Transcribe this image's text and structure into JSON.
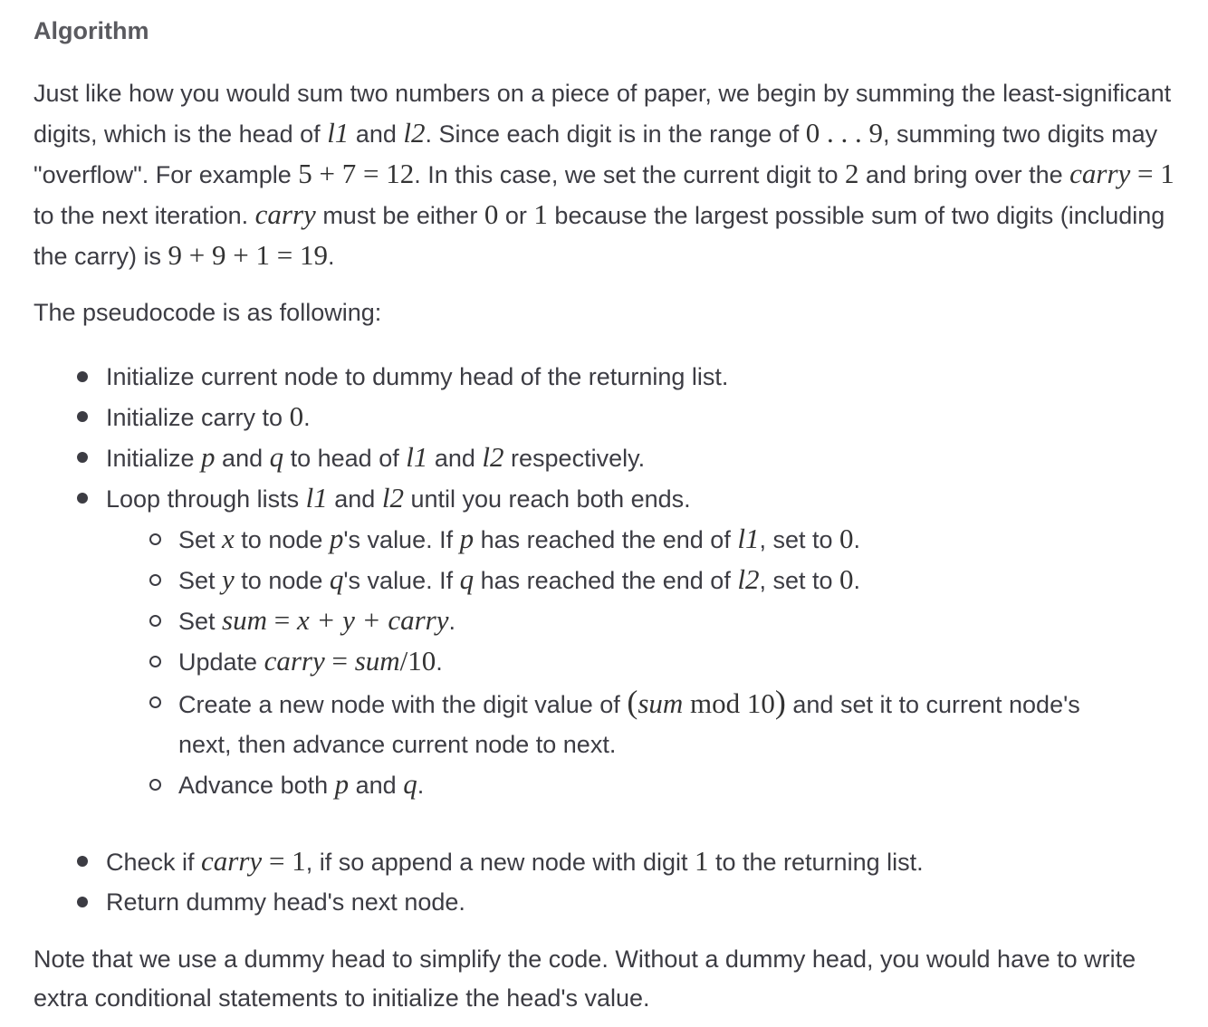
{
  "heading": "Algorithm",
  "intro": {
    "p1": "Just like how you would sum two numbers on a piece of paper, we begin by summing the least-significant digits, which is the head of ",
    "l1": "l1",
    "and": " and ",
    "l2": "l2",
    "p2": ". Since each digit is in the range of ",
    "range": "0 . . . 9",
    "p3": ", summing two digits may \"overflow\". For example ",
    "example": "5 + 7 = 12",
    "p4": ". In this case, we set the current digit to ",
    "two": "2",
    "p5": " and bring over the ",
    "carry_eq": "carry",
    "carry_eq_val": " = 1",
    "p6": " to the next iteration. ",
    "carry2": "carry",
    "p7": " must be either ",
    "zero": "0",
    "or": " or ",
    "one": "1",
    "p8": " because the largest possible sum of two digits (including the carry) is ",
    "maxsum": "9 + 9 + 1 = 19",
    "p9": "."
  },
  "pseudo_intro": "The pseudocode is as following:",
  "steps": {
    "s1": "Initialize current node to dummy head of the returning list.",
    "s2_a": "Initialize carry to ",
    "s2_zero": "0",
    "s2_b": ".",
    "s3_a": "Initialize ",
    "s3_p": "p",
    "s3_b": " and ",
    "s3_q": "q",
    "s3_c": " to head of ",
    "s3_l1": "l1",
    "s3_d": " and ",
    "s3_l2": "l2",
    "s3_e": " respectively.",
    "s4_a": "Loop through lists ",
    "s4_l1": "l1",
    "s4_b": " and ",
    "s4_l2": "l2",
    "s4_c": " until you reach both ends.",
    "sub": {
      "a1": "Set ",
      "a_x": "x",
      "a2": " to node ",
      "a_p": "p",
      "a3": "'s value. If ",
      "a_p2": "p",
      "a4": " has reached the end of ",
      "a_l1": "l1",
      "a5": ", set to ",
      "a_zero": "0",
      "a6": ".",
      "b1": "Set ",
      "b_y": "y",
      "b2": " to node ",
      "b_q": "q",
      "b3": "'s value. If ",
      "b_q2": "q",
      "b4": " has reached the end of ",
      "b_l2": "l2",
      "b5": ", set to ",
      "b_zero": "0",
      "b6": ".",
      "c1": "Set ",
      "c_sum": "sum",
      "c_eq": " = ",
      "c_expr": "x + y + carry",
      "c2": ".",
      "d1": "Update ",
      "d_carry": "carry",
      "d_eq": " = ",
      "d_sum": "sum",
      "d_div": "/10",
      "d2": ".",
      "e1": "Create a new node with the digit value of ",
      "e_open": "(",
      "e_sum": "sum",
      "e_mod": " mod 10",
      "e_close": ")",
      "e2": " and set it to current node's next, then advance current node to next.",
      "f1": "Advance both ",
      "f_p": "p",
      "f2": " and ",
      "f_q": "q",
      "f3": "."
    },
    "s5_a": "Check if ",
    "s5_carry": "carry",
    "s5_eq": " = 1",
    "s5_b": ", if so append a new node with digit ",
    "s5_one": "1",
    "s5_c": " to the returning list.",
    "s6": "Return dummy head's next node."
  },
  "note": "Note that we use a dummy head to simplify the code. Without a dummy head, you would have to write extra conditional statements to initialize the head's value."
}
